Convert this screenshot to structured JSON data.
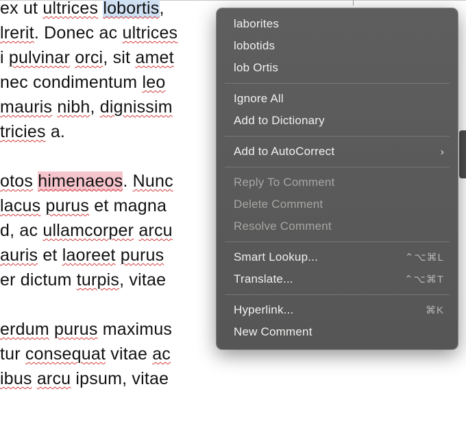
{
  "document": {
    "selected_word_1": "lobortis",
    "selected_word_2": "himenaeos",
    "para1_prefix": "ex ut ",
    "para1_word_ultrices": "ultrices",
    "para1_after_sel": ",",
    "line2_a": "lrerit",
    "line2_b": ". Donec ac ",
    "line2_c": "ultrices",
    "line3_a": "i ",
    "line3_b": "pulvinar",
    "line3_c": " ",
    "line3_d": "orci",
    "line3_e": ", sit ",
    "line3_f": "amet",
    "line4_a": " nec condimentum ",
    "line4_b": "leo",
    "line5_a": "mauris",
    "line5_b": " ",
    "line5_c": "nibh",
    "line5_d": ", ",
    "line5_e": "dignissim",
    "line6_a": "tricies",
    "line6_b": " a.",
    "para2_a": "otos",
    "para2_b": ". ",
    "para2_c": "Nunc",
    "line8_a": " ",
    "line8_b": "lacus",
    "line8_c": " ",
    "line8_d": "purus",
    "line8_e": " et magna",
    "line9_a": "d, ac ",
    "line9_b": "ullamcorper",
    "line9_c": " ",
    "line9_d": "arcu",
    "line10_a": "auris",
    "line10_b": " et ",
    "line10_c": "laoreet",
    "line10_d": " ",
    "line10_e": "purus",
    "line11_a": "er dictum ",
    "line11_b": "turpis",
    "line11_c": ", vitae",
    "para3_a": "erdum",
    "para3_b": " ",
    "para3_c": "purus",
    "para3_d": " maximus",
    "line14_a": "tur ",
    "line14_b": "consequat",
    "line14_c": " vitae ",
    "line14_d": "ac",
    "line15_a": "ibus",
    "line15_b": " ",
    "line15_c": "arcu",
    "line15_d": " ipsum, vitae"
  },
  "menu": {
    "suggestions": [
      "laborites",
      "lobotids",
      "lob Ortis"
    ],
    "ignore_all": "Ignore All",
    "add_dict": "Add to Dictionary",
    "add_auto": "Add to AutoCorrect",
    "reply": "Reply To Comment",
    "delete": "Delete Comment",
    "resolve": "Resolve Comment",
    "smart_lookup": "Smart Lookup...",
    "smart_lookup_key": "⌃⌥⌘L",
    "translate": "Translate...",
    "translate_key": "⌃⌥⌘T",
    "hyperlink": "Hyperlink...",
    "hyperlink_key": "⌘K",
    "new_comment": "New Comment",
    "chevron": "›"
  }
}
